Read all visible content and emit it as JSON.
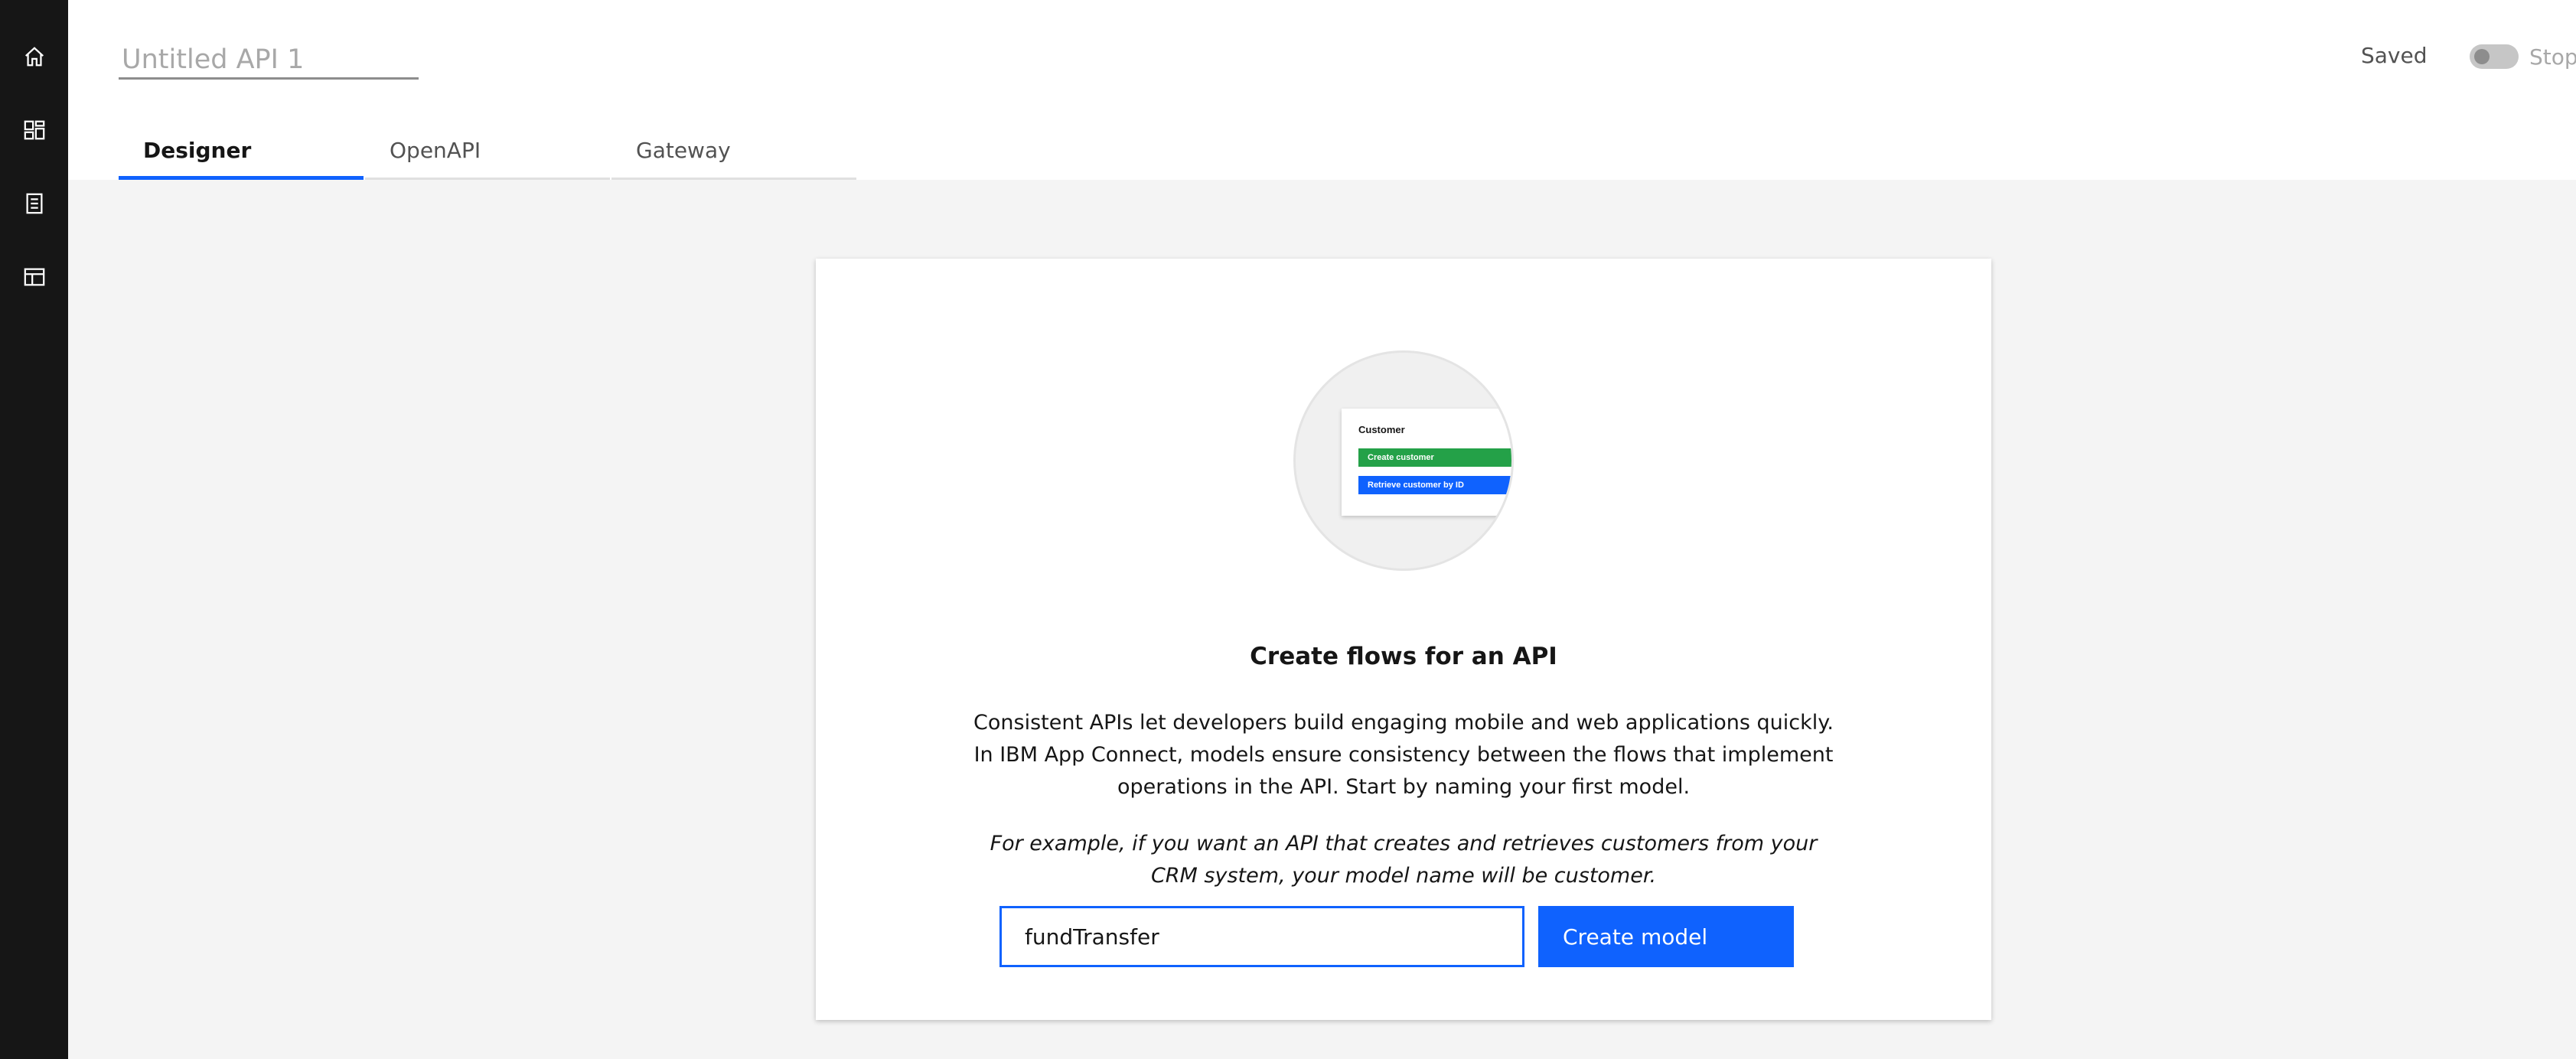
{
  "sidebar": {
    "items": [
      {
        "icon": "home-icon"
      },
      {
        "icon": "dashboard-icon"
      },
      {
        "icon": "catalog-icon"
      },
      {
        "icon": "templates-icon"
      }
    ]
  },
  "header": {
    "title_placeholder": "Untitled API 1",
    "status": "Saved",
    "toggle_label": "Stop"
  },
  "tabs": [
    {
      "label": "Designer",
      "active": true
    },
    {
      "label": "OpenAPI",
      "active": false
    },
    {
      "label": "Gateway",
      "active": false
    }
  ],
  "illustration": {
    "card_title": "Customer",
    "operations": [
      {
        "label": "Create customer",
        "color": "#24a148"
      },
      {
        "label": "Retrieve customer by ID",
        "color": "#0f62fe"
      }
    ]
  },
  "main": {
    "heading": "Create flows for an API",
    "body": "Consistent APIs let developers build engaging mobile and web applications quickly. In IBM App Connect, models ensure consistency between the flows that implement operations in the API. Start by naming your first model.",
    "example": "For example, if you want an API that creates and retrieves customers from your CRM system, your model name will be customer.",
    "model_input_value": "fundTransfer",
    "create_button": "Create model"
  },
  "colors": {
    "accent": "#0f62fe",
    "sidebar": "#161616",
    "background": "#f4f4f4"
  }
}
